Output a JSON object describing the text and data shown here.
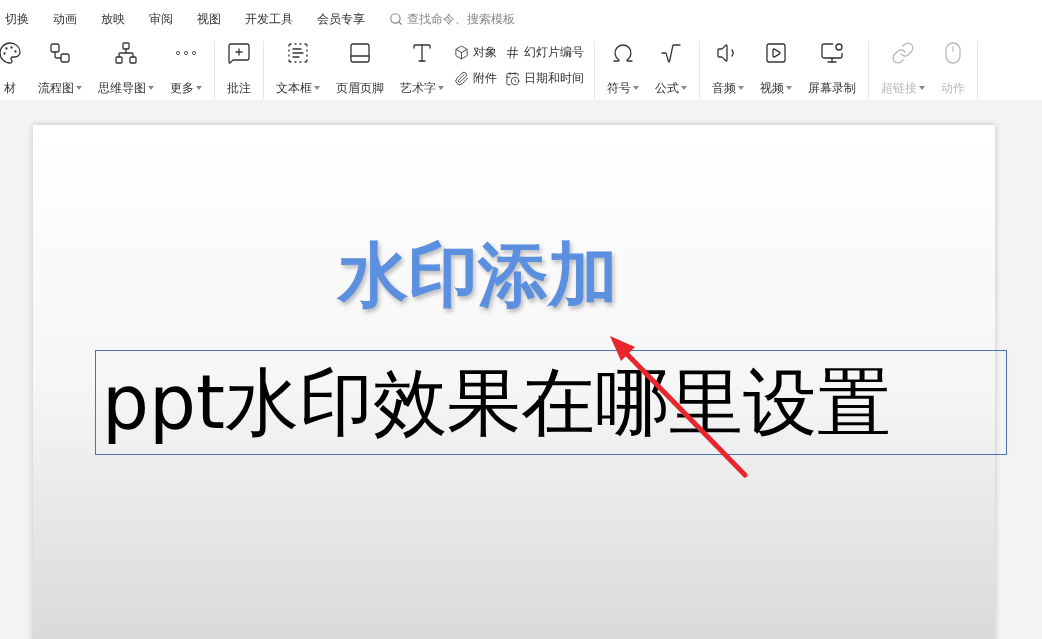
{
  "tabs": [
    {
      "label": "切换",
      "selected": false
    },
    {
      "label": "动画",
      "selected": false
    },
    {
      "label": "放映",
      "selected": false
    },
    {
      "label": "审阅",
      "selected": false
    },
    {
      "label": "视图",
      "selected": false
    },
    {
      "label": "开发工具",
      "selected": false
    },
    {
      "label": "会员专享",
      "selected": false
    }
  ],
  "search": {
    "placeholder": "查找命令、搜索模板"
  },
  "toolbar": [
    {
      "items": [
        {
          "kind": "large",
          "label": "材",
          "dropdown": false,
          "disabled": false
        },
        {
          "kind": "large",
          "label": "流程图",
          "dropdown": true,
          "disabled": false
        },
        {
          "kind": "large",
          "label": "思维导图",
          "dropdown": true,
          "disabled": false
        },
        {
          "kind": "large",
          "label": "更多",
          "dropdown": true,
          "disabled": false
        }
      ]
    },
    {
      "items": [
        {
          "kind": "large",
          "label": "批注",
          "dropdown": false,
          "disabled": false
        }
      ]
    },
    {
      "items": [
        {
          "kind": "large",
          "label": "文本框",
          "dropdown": true,
          "disabled": false
        },
        {
          "kind": "large",
          "label": "页眉页脚",
          "dropdown": false,
          "disabled": false
        },
        {
          "kind": "large",
          "label": "艺术字",
          "dropdown": true,
          "disabled": false
        },
        {
          "kind": "small",
          "label": "对象",
          "dropdown": false,
          "disabled": false
        },
        {
          "kind": "small",
          "label": "附件",
          "dropdown": false,
          "disabled": false
        },
        {
          "kind": "small",
          "label": "幻灯片编号",
          "dropdown": false,
          "disabled": false
        },
        {
          "kind": "small",
          "label": "日期和时间",
          "dropdown": false,
          "disabled": false
        }
      ]
    },
    {
      "items": [
        {
          "kind": "large",
          "label": "符号",
          "dropdown": true,
          "disabled": false
        },
        {
          "kind": "large",
          "label": "公式",
          "dropdown": true,
          "disabled": false
        }
      ]
    },
    {
      "items": [
        {
          "kind": "large",
          "label": "音频",
          "dropdown": true,
          "disabled": false
        },
        {
          "kind": "large",
          "label": "视频",
          "dropdown": true,
          "disabled": false
        },
        {
          "kind": "large",
          "label": "屏幕录制",
          "dropdown": false,
          "disabled": false
        }
      ]
    },
    {
      "items": [
        {
          "kind": "large",
          "label": "超链接",
          "dropdown": true,
          "disabled": true
        },
        {
          "kind": "large",
          "label": "动作",
          "dropdown": false,
          "disabled": true
        }
      ]
    }
  ],
  "slide": {
    "title": "水印添加",
    "text_box": "ppt水印效果在哪里设置"
  }
}
